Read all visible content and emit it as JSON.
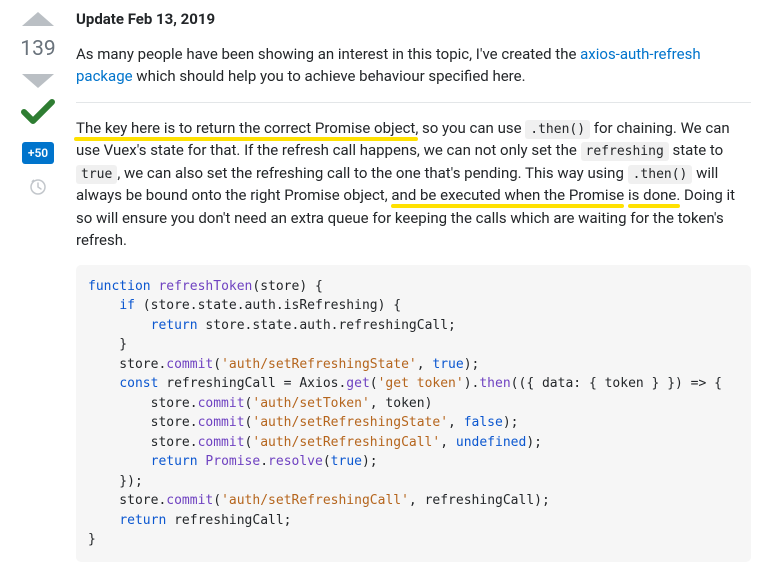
{
  "vote": {
    "score": "139",
    "bounty": "+50"
  },
  "post": {
    "updateHeading": "Update Feb 13, 2019",
    "intro": {
      "t1": "As many people have been showing an interest in this topic, I've created the ",
      "link": "axios-auth-refresh package",
      "t2": " which should help you to achieve behaviour specified here."
    },
    "body": {
      "s1": "The key here is to return the correct Promise object,",
      "s2": " so you can use ",
      "c1": ".then()",
      "s3": " for chaining. We can use Vuex's state for that. If the refresh call happens, we can not only set the ",
      "c2": "refreshing",
      "s4": " state to ",
      "c3": "true",
      "s5": ", we can also set the refreshing call to the one that's pending. This way using ",
      "c4": ".then()",
      "s6": " will always be bound onto the right Promise object, ",
      "s7": "and be executed when the Promise",
      "s8": "is done.",
      "s9": " Doing it so will ensure you don't need an extra queue for keeping the calls which are waiting for the token's refresh."
    },
    "code": {
      "l01a": "function",
      "l01b": " ",
      "l01c": "refreshToken",
      "l01d": "(store) {",
      "l02a": "    ",
      "l02b": "if",
      "l02c": " (store.state.auth.isRefreshing) {",
      "l03a": "        ",
      "l03b": "return",
      "l03c": " store.state.auth.refreshingCall;",
      "l04": "    }",
      "l05a": "    store.",
      "l05b": "commit",
      "l05c": "(",
      "l05d": "'auth/setRefreshingState'",
      "l05e": ", ",
      "l05f": "true",
      "l05g": ");",
      "l06a": "    ",
      "l06b": "const",
      "l06c": " refreshingCall = Axios.",
      "l06d": "get",
      "l06e": "(",
      "l06f": "'get token'",
      "l06g": ").",
      "l06h": "then",
      "l06i": "(({ data: { token } }) => {",
      "l07a": "        store.",
      "l07b": "commit",
      "l07c": "(",
      "l07d": "'auth/setToken'",
      "l07e": ", token)",
      "l08a": "        store.",
      "l08b": "commit",
      "l08c": "(",
      "l08d": "'auth/setRefreshingState'",
      "l08e": ", ",
      "l08f": "false",
      "l08g": ");",
      "l09a": "        store.",
      "l09b": "commit",
      "l09c": "(",
      "l09d": "'auth/setRefreshingCall'",
      "l09e": ", ",
      "l09f": "undefined",
      "l09g": ");",
      "l10a": "        ",
      "l10b": "return",
      "l10c": " ",
      "l10d": "Promise",
      "l10e": ".",
      "l10f": "resolve",
      "l10g": "(",
      "l10h": "true",
      "l10i": ");",
      "l11": "    });",
      "l12a": "    store.",
      "l12b": "commit",
      "l12c": "(",
      "l12d": "'auth/setRefreshingCall'",
      "l12e": ", refreshingCall);",
      "l13a": "    ",
      "l13b": "return",
      "l13c": " refreshingCall;",
      "l14": "}"
    }
  }
}
